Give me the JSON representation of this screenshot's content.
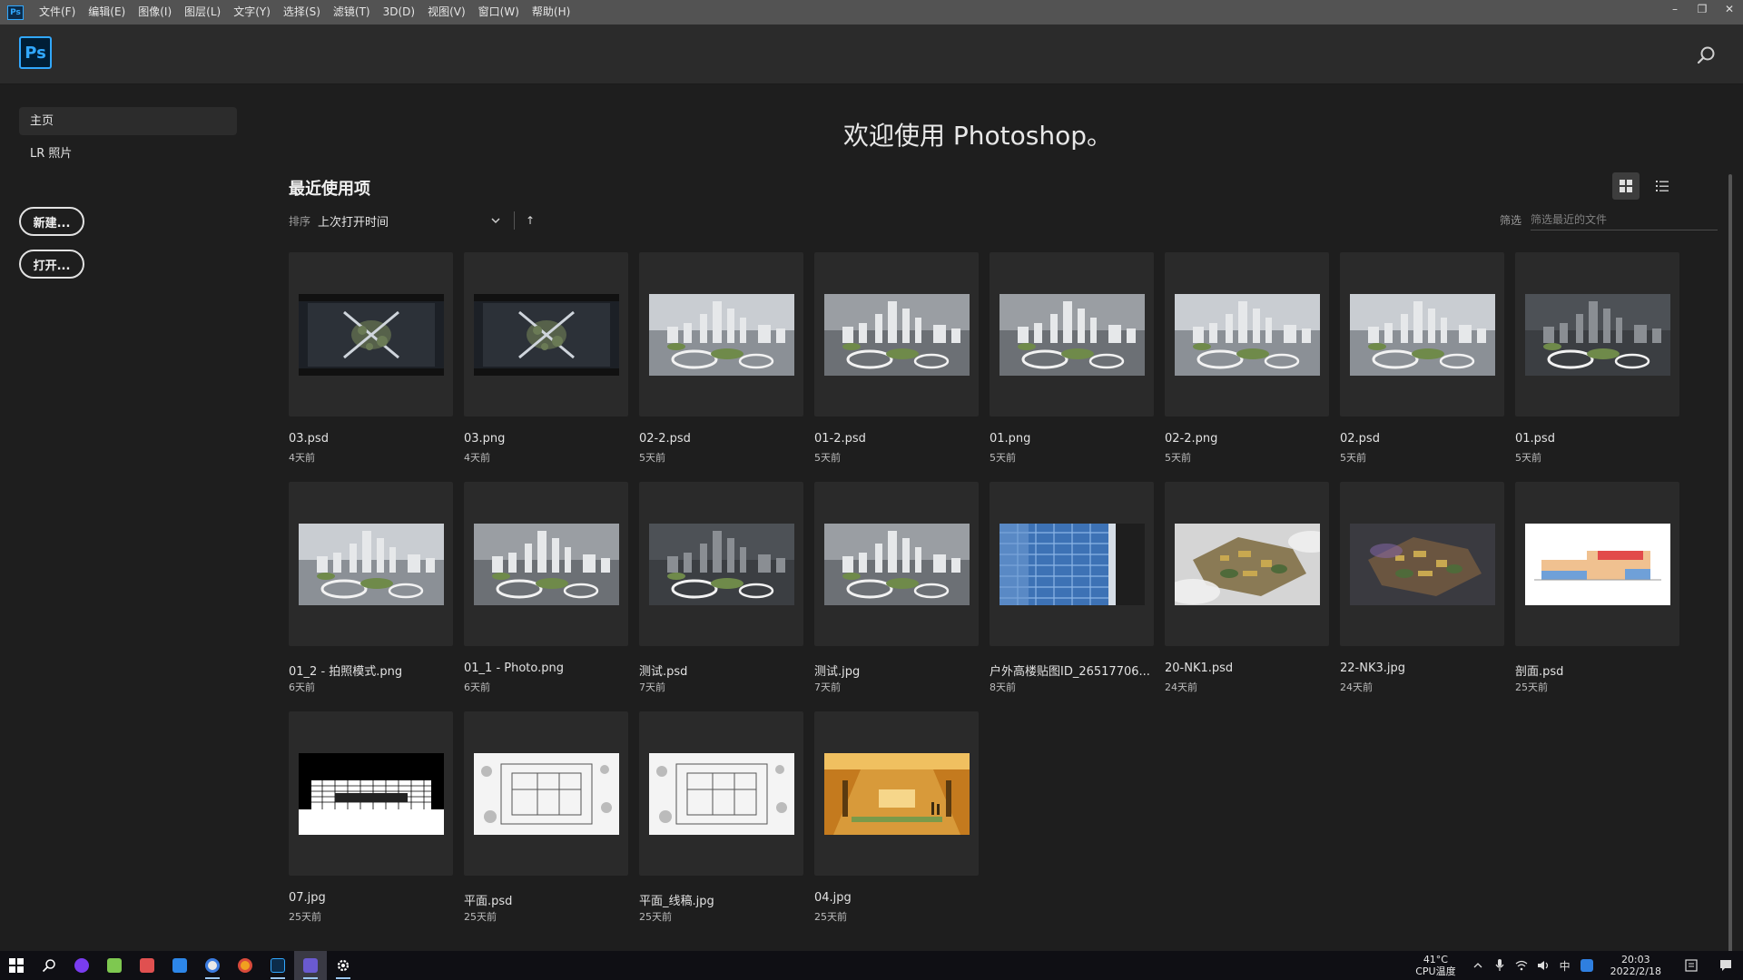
{
  "menubar": {
    "app_badge": "Ps",
    "items": [
      "文件(F)",
      "编辑(E)",
      "图像(I)",
      "图层(L)",
      "文字(Y)",
      "选择(S)",
      "滤镜(T)",
      "3D(D)",
      "视图(V)",
      "窗口(W)",
      "帮助(H)"
    ],
    "controls": {
      "minimize": "–",
      "restore": "❐",
      "close": "✕"
    }
  },
  "header": {
    "logo": "Ps"
  },
  "sidebar": {
    "items": [
      {
        "label": "主页",
        "active": true
      },
      {
        "label": "LR 照片",
        "active": false
      }
    ],
    "new_button": "新建...",
    "open_button": "打开..."
  },
  "main": {
    "welcome": "欢迎使用 Photoshop。",
    "recent_title": "最近使用项",
    "sort": {
      "label": "排序",
      "value": "上次打开时间",
      "direction": "↑"
    },
    "filter": {
      "label": "筛选",
      "placeholder": "筛选最近的文件"
    }
  },
  "files": [
    {
      "name": "03.psd",
      "age": "4天前",
      "thumb": "aerial-dark"
    },
    {
      "name": "03.png",
      "age": "4天前",
      "thumb": "aerial-dark"
    },
    {
      "name": "02-2.psd",
      "age": "5天前",
      "thumb": "city-bright"
    },
    {
      "name": "01-2.psd",
      "age": "5天前",
      "thumb": "city-gray"
    },
    {
      "name": "01.png",
      "age": "5天前",
      "thumb": "city-gray"
    },
    {
      "name": "02-2.png",
      "age": "5天前",
      "thumb": "city-bright"
    },
    {
      "name": "02.psd",
      "age": "5天前",
      "thumb": "city-bright"
    },
    {
      "name": "01.psd",
      "age": "5天前",
      "thumb": "city-dark"
    },
    {
      "name": "01_2 - 拍照模式.png",
      "age": "6天前",
      "thumb": "city-bright"
    },
    {
      "name": "01_1 - Photo.png",
      "age": "6天前",
      "thumb": "city-gray"
    },
    {
      "name": "测试.psd",
      "age": "7天前",
      "thumb": "city-dark"
    },
    {
      "name": "测试.jpg",
      "age": "7天前",
      "thumb": "city-gray"
    },
    {
      "name": "户外高楼贴图ID_26517706...",
      "age": "8天前",
      "thumb": "facade-blue"
    },
    {
      "name": "20-NK1.psd",
      "age": "24天前",
      "thumb": "site-cloud"
    },
    {
      "name": "22-NK3.jpg",
      "age": "24天前",
      "thumb": "site-dark"
    },
    {
      "name": "剖面.psd",
      "age": "25天前",
      "thumb": "section"
    },
    {
      "name": "07.jpg",
      "age": "25天前",
      "thumb": "elevation"
    },
    {
      "name": "平面.psd",
      "age": "25天前",
      "thumb": "plan"
    },
    {
      "name": "平面_线稿.jpg",
      "age": "25天前",
      "thumb": "plan"
    },
    {
      "name": "04.jpg",
      "age": "25天前",
      "thumb": "interior"
    }
  ],
  "taskbar": {
    "temperature": "41°C",
    "temp_label": "CPU温度",
    "ime": "中",
    "time": "20:03",
    "date": "2022/2/18",
    "icons": [
      "windows-start-icon",
      "search-icon",
      "app-purple-icon",
      "app-clover-icon",
      "app-store-icon",
      "app-blue-icon",
      "chrome-icon",
      "chrome-alt-icon",
      "photoshop-icon",
      "app-p-icon",
      "settings-icon"
    ]
  },
  "colors": {
    "accent": "#31a8ff",
    "background": "#1e1e1e",
    "header": "#2b2b2b",
    "menubar": "#535353"
  }
}
